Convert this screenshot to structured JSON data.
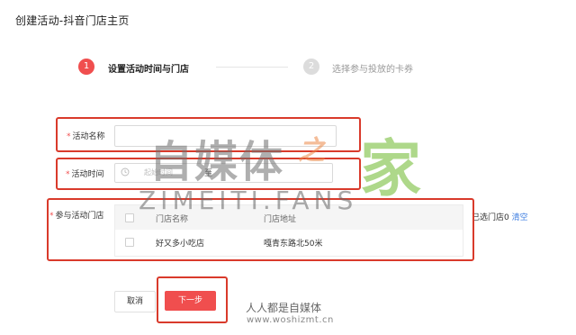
{
  "page": {
    "title": "创建活动-抖音门店主页"
  },
  "steps": [
    {
      "number": "1",
      "label": "设置活动时间与门店",
      "state": "active"
    },
    {
      "number": "2",
      "label": "选择参与投放的卡券",
      "state": "inactive"
    }
  ],
  "form": {
    "name": {
      "required_mark": "*",
      "label": "活动名称",
      "value": ""
    },
    "time": {
      "required_mark": "*",
      "label": "活动时间",
      "start_placeholder": "起始时间",
      "separator": "至"
    },
    "stores": {
      "required_mark": "*",
      "label": "参与活动门店",
      "columns": [
        "门店名称",
        "门店地址"
      ],
      "rows": [
        {
          "name": "好又多小吃店",
          "address": "嘎青东路北50米"
        }
      ],
      "selected_text": "已选门店0",
      "clear_label": "清空"
    }
  },
  "buttons": {
    "cancel": "取消",
    "next": "下一步"
  },
  "watermark": {
    "main": "自媒体",
    "zhi": "之",
    "jia": "家",
    "english": "ZIMEITI.FANS",
    "footer_cn": "人人都是自媒体",
    "footer_url": "www.woshizmt.cn"
  },
  "colors": {
    "accent": "#f04e4e",
    "annotation": "#d93a2b",
    "link": "#3a7be0",
    "step_inactive": "#dcdcdc"
  }
}
